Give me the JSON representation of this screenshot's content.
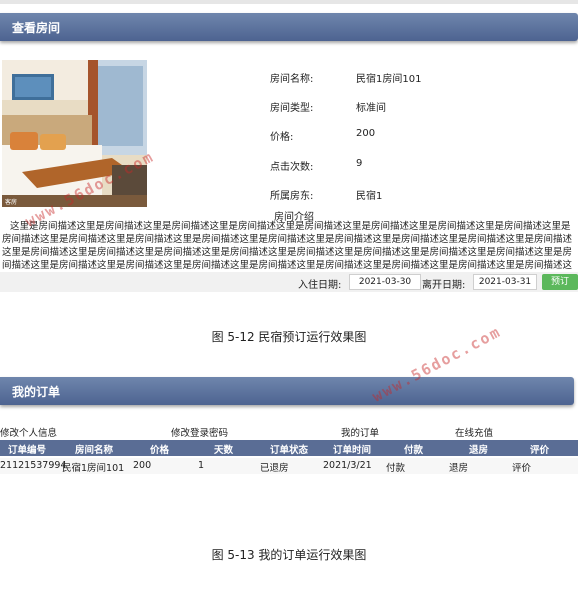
{
  "section1": {
    "header_title": "查看房间",
    "info": [
      {
        "label": "房间名称:",
        "value": "民宿1房间101"
      },
      {
        "label": "房间类型:",
        "value": "标准间"
      },
      {
        "label": "价格:",
        "value": "200"
      },
      {
        "label": "点击次数:",
        "value": "9"
      },
      {
        "label": "所属房东:",
        "value": "民宿1"
      }
    ],
    "desc_title": "房间介绍",
    "desc_text": "这里是房间描述这里是房间描述这里是房间描述这里是房间描述这里是房间描述这里是房间描述这里是房间描述这里是房间描述这里是房间描述这里是房间描述这里是房间描述这里是房间描述这里是房间描述这里是房间描述这里是房间描述这里是房间描述这里是房间描述这里是房间描述这里是房间描述这里是房间描述这里是房间描述这里是房间描述这里是房间描述这里是房间描述这里是房间描述这里是房间描述这里是房间描述这里是房间描述这里是房间描述这里是房间描述这里是房间描述这里是房间描述这里是房间描述这里是房间描述这里是房间描述这里是房间描述这里是房间描述这里是房间描述这里是房间描述这里是房间描述这里是房间描述",
    "checkin_label": "入住日期:",
    "checkin_value": "2021-03-30",
    "checkout_label": "离开日期:",
    "checkout_value": "2021-03-31",
    "book_button": "预订",
    "photo_caption": "客房"
  },
  "caption1": "图 5-12 民宿预订运行效果图",
  "section2": {
    "header_title": "我的订单",
    "menu": [
      "修改个人信息",
      "修改登录密码",
      "我的订单",
      "在线充值"
    ],
    "columns": [
      "订单编号",
      "房间名称",
      "价格",
      "天数",
      "订单状态",
      "订单时间",
      "付款",
      "退房",
      "评价"
    ],
    "row": [
      "21121537994",
      "民宿1房间101",
      "200",
      "1",
      "已退房",
      "2021/3/21",
      "付款",
      "退房",
      "评价"
    ]
  },
  "caption2": "图 5-13 我的订单运行效果图",
  "watermark": "www.56doc.com",
  "colors": {
    "header": "#5a6d95",
    "book_button": "#5cb85c",
    "watermark": "#c82828"
  }
}
